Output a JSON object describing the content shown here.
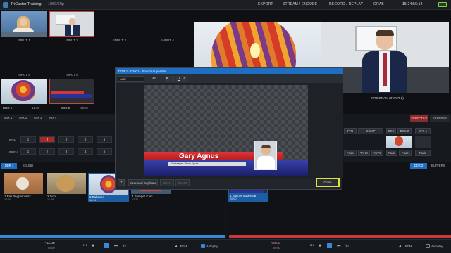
{
  "topbar": {
    "app_title": "TriCaster Training",
    "resolution": "1080/60p",
    "menus": [
      "EXPORT",
      "STREAM / ENCODE",
      "RECORD / REPLAY",
      "GRAB"
    ],
    "clock": "15:24:56:12"
  },
  "inputs": {
    "row1": [
      "INPUT 1",
      "INPUT 2",
      "INPUT 3",
      "INPUT 4"
    ],
    "row2": [
      "INPUT 5",
      "INPUT 6"
    ]
  },
  "ddr_labels": [
    "DDR 1",
    "DDR 2"
  ],
  "ddr_times": [
    "-12:00",
    "-05:00"
  ],
  "program_label": "PROGRAM (INPUT 2)",
  "mix_tabs": [
    "MIX 1",
    "MIX 2",
    "MIX 3",
    "MIX 4"
  ],
  "mix_rows": {
    "pgm": {
      "label": "PGM",
      "cells": [
        "1",
        "2",
        "3",
        "4",
        "5"
      ]
    },
    "prev": {
      "label": "PREV",
      "cells": [
        "1",
        "2",
        "3",
        "4",
        "5"
      ]
    }
  },
  "right_tabs": [
    "EFFECTIVE",
    "EXPRESS"
  ],
  "transition": {
    "buttons": [
      "FTB",
      "COMP",
      "DSK 1",
      "DSK 2",
      "BFX 1"
    ],
    "sub": [
      "Fade",
      "TAKE",
      "AUTO",
      "Fade",
      "Fade",
      "Fade"
    ]
  },
  "ddr_tabs_left": [
    "DDR 1",
    "SOUND"
  ],
  "ddr_tabs_right": [
    "DDR 2",
    "BUFFERS"
  ],
  "dialog": {
    "title": "DDR 1 · DSY 1 · Soccer Superstar",
    "font_field": "Arial",
    "font_size": "48",
    "toolbar_buttons": [
      "B",
      "I",
      "U",
      "A"
    ],
    "name_text": "Gary Agnus",
    "lower_strip_text": "Goalkeeper · Team Sports",
    "bottom_buttons": [
      "Save and Duplicate",
      "Save",
      "Revert"
    ],
    "close_label": "Close",
    "add_label": "+"
  },
  "clips_left": [
    {
      "num": "1",
      "title": "Ball Pepper Work",
      "time": "12:29"
    },
    {
      "num": "2",
      "title": "Lion",
      "time": "11:28"
    },
    {
      "num": "3",
      "title": "Balloons",
      "time": "12:01"
    },
    {
      "num": "4",
      "title": "Bumper Cars",
      "time": "12:21"
    }
  ],
  "clips_right": [
    {
      "num": "1",
      "title": "Soccer Superstar",
      "time": "00:00"
    }
  ],
  "bottom": {
    "left_time": "-12:00",
    "left_sub": "00:00",
    "right_time": "-05:00",
    "right_sub": "00:00",
    "play_label": "PGM",
    "autoplay_label": "Autoplay"
  },
  "colors": {
    "accent": "#1e6fc4",
    "red_bar": "#c53a3a",
    "close_highlight": "#e2e334"
  }
}
